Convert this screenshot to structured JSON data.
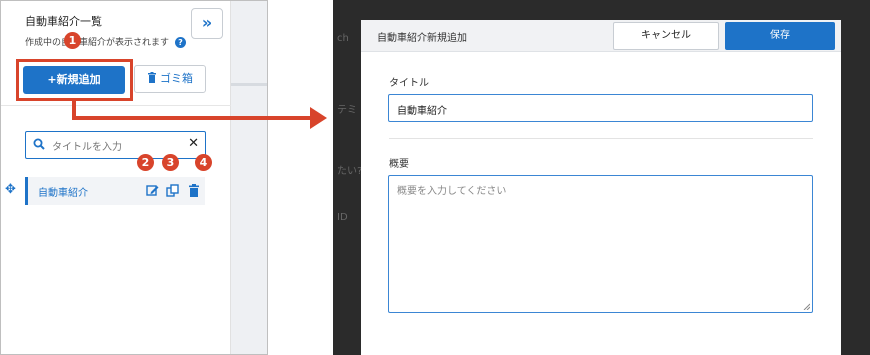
{
  "sidebar": {
    "title": "自動車紹介一覧",
    "subtitle": "作成中の自動車紹介が表示されます",
    "add_button": "+新規追加",
    "trash_button": "ゴミ箱",
    "search_placeholder": "タイトルを入力",
    "items": [
      {
        "label": "自動車紹介"
      }
    ]
  },
  "markers": [
    "1",
    "2",
    "3",
    "4"
  ],
  "modal": {
    "header_title": "自動車紹介新規追加",
    "cancel_button": "キャンセル",
    "save_button": "保存",
    "title_label": "タイトル",
    "title_value": "自動車紹介",
    "description_label": "概要",
    "description_placeholder": "概要を入力してください"
  },
  "background_hints": [
    "ch",
    "テミ",
    "たい?",
    "ID"
  ],
  "colors": {
    "accent": "#1e73c8",
    "marker": "#d8442b",
    "overlay": "#2b2b2b"
  },
  "icons": [
    "double-chevron-right-icon",
    "help-icon",
    "trash-icon",
    "search-icon",
    "close-icon",
    "move-icon",
    "edit-icon",
    "copy-icon",
    "delete-icon",
    "arrow-right-icon",
    "resize-grip-icon"
  ]
}
